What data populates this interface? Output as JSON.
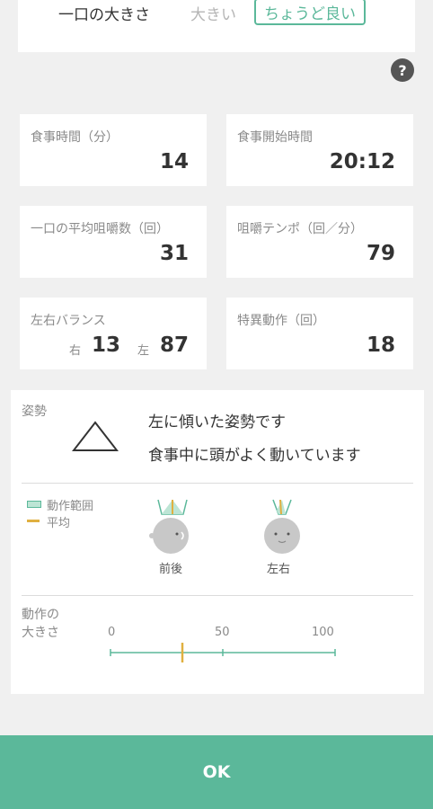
{
  "bite": {
    "label": "一口の大きさ",
    "opt_big": "大きい",
    "opt_good": "ちょうど良い"
  },
  "help": {
    "glyph": "?"
  },
  "metrics": {
    "meal_time": {
      "label": "食事時間（分）",
      "value": "14"
    },
    "start_time": {
      "label": "食事開始時間",
      "value": "20:12"
    },
    "avg_chew": {
      "label": "一口の平均咀嚼数（回）",
      "value": "31"
    },
    "tempo": {
      "label": "咀嚼テンポ（回／分）",
      "value": "79"
    },
    "balance": {
      "label": "左右バランス",
      "right_label": "右",
      "right_value": "13",
      "left_label": "左",
      "left_value": "87"
    },
    "special": {
      "label": "特異動作（回）",
      "value": "18"
    }
  },
  "posture": {
    "title": "姿勢",
    "icon": "triangle-icon",
    "message1": "左に傾いた姿勢です",
    "message2": "食事中に頭がよく動いています",
    "legend": {
      "range": "動作範囲",
      "average": "平均"
    },
    "heads": {
      "front_back": "前後",
      "left_right": "左右"
    },
    "movement": {
      "label_line1": "動作の",
      "label_line2": "大きさ",
      "ticks": [
        "0",
        "50",
        "100"
      ],
      "average_value": 32
    }
  },
  "colors": {
    "accent": "#5bb89a",
    "average": "#e0b040"
  },
  "ok_button": {
    "label": "OK"
  }
}
